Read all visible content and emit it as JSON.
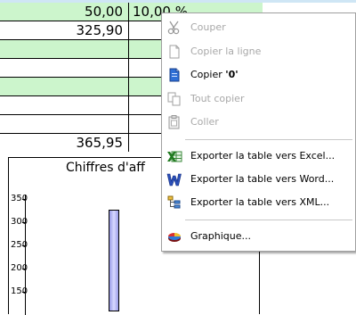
{
  "table": {
    "rows": [
      {
        "style": "green",
        "value": "50,00",
        "second": "10,00 %"
      },
      {
        "style": "white",
        "value": "325,90",
        "second": ""
      },
      {
        "style": "green",
        "value": "",
        "second": ""
      },
      {
        "style": "white",
        "value": "",
        "second": ""
      },
      {
        "style": "green",
        "value": "",
        "second": ""
      },
      {
        "style": "white",
        "value": "",
        "second": ""
      },
      {
        "style": "white",
        "value": "",
        "second": ""
      },
      {
        "style": "white",
        "value": "365,95",
        "second": ""
      }
    ]
  },
  "chart": {
    "title": "Chiffres d'aff",
    "yticks": [
      "350",
      "300",
      "250",
      "200",
      "150"
    ]
  },
  "chart_data": {
    "type": "bar",
    "title": "Chiffres d'aff",
    "xlabel": "",
    "ylabel": "",
    "ylim": [
      130,
      355
    ],
    "yticks": [
      350,
      300,
      250,
      200,
      150
    ],
    "bars": [
      {
        "value": 326
      }
    ]
  },
  "menu": {
    "items": [
      {
        "label": "Couper",
        "icon": "scissors-icon",
        "enabled": false
      },
      {
        "label": "Copier la ligne",
        "icon": "page-icon",
        "enabled": false
      },
      {
        "label": "Copier '0'",
        "icon": "copy-page-icon",
        "enabled": true
      },
      {
        "label": "Tout copier",
        "icon": "copy-all-icon",
        "enabled": false
      },
      {
        "label": "Coller",
        "icon": "paste-icon",
        "enabled": false
      },
      {
        "label": "Exporter la table vers Excel...",
        "icon": "excel-icon",
        "enabled": true
      },
      {
        "label": "Exporter la table vers Word...",
        "icon": "word-icon",
        "enabled": true
      },
      {
        "label": "Exporter la table vers XML...",
        "icon": "xml-icon",
        "enabled": true
      },
      {
        "label": "Graphique...",
        "icon": "chart-icon",
        "enabled": true
      }
    ],
    "copy_label_prefix": "Copier ",
    "copy_label_value": "'0'"
  },
  "colors": {
    "row_green": "#ccf5cc",
    "bar_fill": "#b4b5f5",
    "disabled_text": "#a8a8a8"
  }
}
